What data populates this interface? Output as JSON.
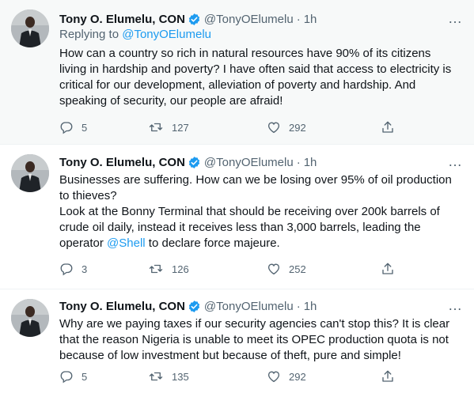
{
  "tweets": [
    {
      "author": "Tony O. Elumelu, CON",
      "handle": "@TonyOElumelu",
      "time": "1h",
      "replying_to_label": "Replying to",
      "replying_to_handle": "@TonyOElumelu",
      "lines": [
        "How can a country so rich in natural resources have 90% of its citizens",
        "living in hardship and poverty? I have often said that access to electricity is",
        "critical for our development, alleviation of poverty and hardship. And",
        "speaking of security, our people are afraid!"
      ],
      "replies": "5",
      "retweets": "127",
      "likes": "292"
    },
    {
      "author": "Tony O. Elumelu, CON",
      "handle": "@TonyOElumelu",
      "time": "1h",
      "lines": [
        "Businesses are suffering. How can we be losing over 95% of oil production",
        "to thieves?",
        "Look at the Bonny Terminal that should be receiving over 200k barrels of",
        "crude oil daily, instead it receives less than 3,000 barrels, leading the"
      ],
      "last_line_pre": "operator ",
      "last_line_mention": "@Shell",
      "last_line_post": " to declare force majeure.",
      "replies": "3",
      "retweets": "126",
      "likes": "252"
    },
    {
      "author": "Tony O. Elumelu, CON",
      "handle": "@TonyOElumelu",
      "time": "1h",
      "lines": [
        "Why are we paying taxes if our security agencies can't stop this? It is clear",
        "that the reason Nigeria is unable to meet its OPEC production quota is not",
        "because of low investment but because of theft, pure and simple!"
      ],
      "replies": "5",
      "retweets": "135",
      "likes": "292"
    }
  ],
  "separator": "·",
  "more_icon": "…",
  "icons": {
    "verified": "verified-badge-icon",
    "reply": "reply-icon",
    "retweet": "retweet-icon",
    "like": "heart-icon",
    "share": "share-icon",
    "more": "more-icon"
  },
  "colors": {
    "link": "#1d9bf0",
    "secondary_text": "#536471",
    "highlight_bg": "#f7f9f9"
  }
}
